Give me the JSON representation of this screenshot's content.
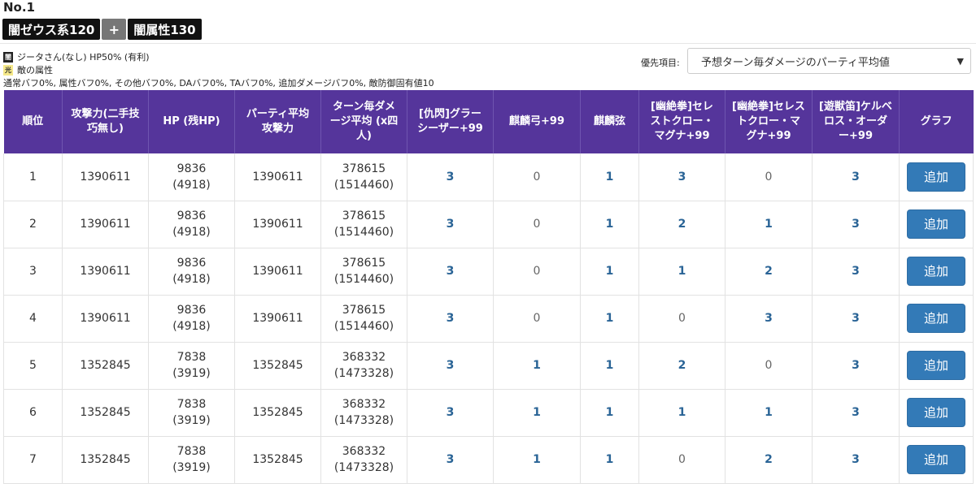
{
  "header": {
    "title": "No.1"
  },
  "tags": {
    "left": "闇ゼウス系120",
    "plus": "+",
    "right": "闇属性130"
  },
  "info": {
    "char_badge": "闇",
    "char_text": "ジータさん(なし) HP50% (有利)",
    "enemy_badge": "光",
    "enemy_text": "敵の属性",
    "buffs": "通常バフ0%, 属性バフ0%, その他バフ0%, DAバフ0%, TAバフ0%, 追加ダメージバフ0%, 敵防御固有値10"
  },
  "priority": {
    "label": "優先項目:",
    "value": "予想ターン毎ダメージのパーティ平均値",
    "arrow": "▼"
  },
  "table": {
    "headers": [
      "順位",
      "攻撃力(二手技巧無し)",
      "HP (残HP)",
      "パーティ平均攻撃力",
      "ターン毎ダメージ平均 (x四人)",
      "[仇閃]グラーシーザー+99",
      "麒麟弓+99",
      "麒麟弦",
      "[幽絶拳]セレストクロー・マグナ+99",
      "[幽絶拳]セレストクロー・マグナ+99",
      "[遊獣笛]ケルベロス・オーダー+99",
      "グラフ"
    ],
    "button_label": "追加",
    "rows": [
      {
        "rank": "1",
        "atk": "1390611",
        "hp": "9836",
        "hp_remain": "(4918)",
        "party_atk": "1390611",
        "dmg": "378615",
        "dmg_total": "(1514460)",
        "c1": "3",
        "c2": "0",
        "c3": "1",
        "c4": "3",
        "c5": "0",
        "c6": "3"
      },
      {
        "rank": "2",
        "atk": "1390611",
        "hp": "9836",
        "hp_remain": "(4918)",
        "party_atk": "1390611",
        "dmg": "378615",
        "dmg_total": "(1514460)",
        "c1": "3",
        "c2": "0",
        "c3": "1",
        "c4": "2",
        "c5": "1",
        "c6": "3"
      },
      {
        "rank": "3",
        "atk": "1390611",
        "hp": "9836",
        "hp_remain": "(4918)",
        "party_atk": "1390611",
        "dmg": "378615",
        "dmg_total": "(1514460)",
        "c1": "3",
        "c2": "0",
        "c3": "1",
        "c4": "1",
        "c5": "2",
        "c6": "3"
      },
      {
        "rank": "4",
        "atk": "1390611",
        "hp": "9836",
        "hp_remain": "(4918)",
        "party_atk": "1390611",
        "dmg": "378615",
        "dmg_total": "(1514460)",
        "c1": "3",
        "c2": "0",
        "c3": "1",
        "c4": "0",
        "c5": "3",
        "c6": "3"
      },
      {
        "rank": "5",
        "atk": "1352845",
        "hp": "7838",
        "hp_remain": "(3919)",
        "party_atk": "1352845",
        "dmg": "368332",
        "dmg_total": "(1473328)",
        "c1": "3",
        "c2": "1",
        "c3": "1",
        "c4": "2",
        "c5": "0",
        "c6": "3"
      },
      {
        "rank": "6",
        "atk": "1352845",
        "hp": "7838",
        "hp_remain": "(3919)",
        "party_atk": "1352845",
        "dmg": "368332",
        "dmg_total": "(1473328)",
        "c1": "3",
        "c2": "1",
        "c3": "1",
        "c4": "1",
        "c5": "1",
        "c6": "3"
      },
      {
        "rank": "7",
        "atk": "1352845",
        "hp": "7838",
        "hp_remain": "(3919)",
        "party_atk": "1352845",
        "dmg": "368332",
        "dmg_total": "(1473328)",
        "c1": "3",
        "c2": "1",
        "c3": "1",
        "c4": "0",
        "c5": "2",
        "c6": "3"
      }
    ]
  }
}
